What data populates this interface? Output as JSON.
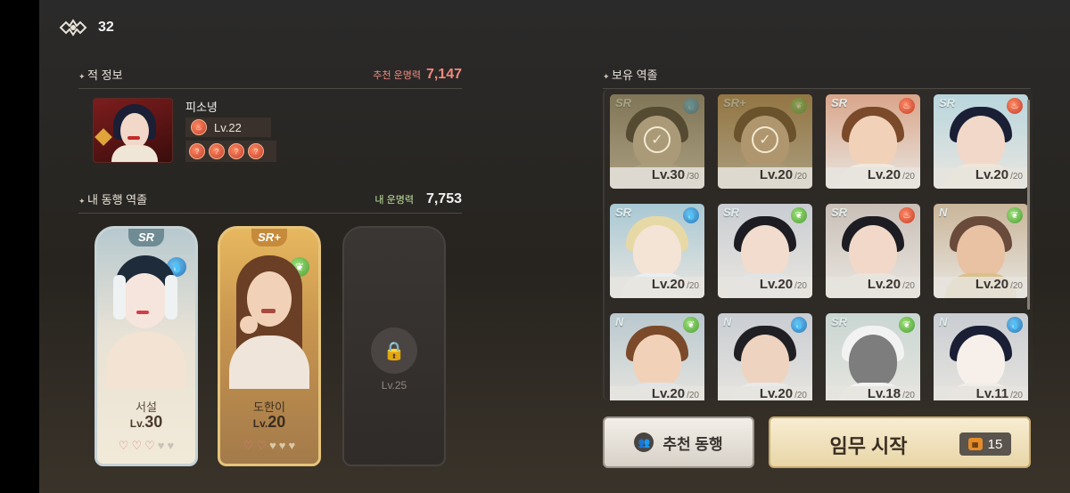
{
  "currency": {
    "icon": "pattern-knot-icon",
    "value": "32"
  },
  "enemy_section": {
    "title": "적 정보",
    "power_label": "추천 운명력",
    "power_value": "7,147",
    "power_color": "#f08a7e",
    "name": "피소녕",
    "level": "Lv.22",
    "element": "fire",
    "element_chips": [
      "?",
      "?",
      "?",
      "?"
    ]
  },
  "party_section": {
    "title": "내 동행 역졸",
    "power_label": "내 운명력",
    "power_value": "7,753",
    "power_color": "#bfe6a0",
    "members": [
      {
        "rank": "SR",
        "element": "water",
        "name": "서설",
        "level_prefix": "Lv.",
        "level": "30",
        "hearts_filled": 3,
        "hearts_total": 5
      },
      {
        "rank": "SR+",
        "element": "leaf",
        "name": "도한이",
        "level_prefix": "Lv.",
        "level": "20",
        "hearts_filled": 2,
        "hearts_total": 5
      }
    ],
    "locked_slot": {
      "label": "Lv.25"
    }
  },
  "owned_section": {
    "title": "보유 역졸",
    "units": [
      {
        "rank": "SR",
        "element": "water",
        "level": "Lv.30",
        "max": "/30",
        "selected": true
      },
      {
        "rank": "SR+",
        "element": "leaf",
        "level": "Lv.20",
        "max": "/20",
        "selected": true
      },
      {
        "rank": "SR",
        "element": "fire",
        "level": "Lv.20",
        "max": "/20",
        "selected": false
      },
      {
        "rank": "SR",
        "element": "fire",
        "level": "Lv.20",
        "max": "/20",
        "selected": false
      },
      {
        "rank": "SR",
        "element": "water",
        "level": "Lv.20",
        "max": "/20",
        "selected": false
      },
      {
        "rank": "SR",
        "element": "leaf",
        "level": "Lv.20",
        "max": "/20",
        "selected": false
      },
      {
        "rank": "SR",
        "element": "fire",
        "level": "Lv.20",
        "max": "/20",
        "selected": false
      },
      {
        "rank": "N",
        "element": "leaf",
        "level": "Lv.20",
        "max": "/20",
        "selected": false
      },
      {
        "rank": "N",
        "element": "leaf",
        "level": "Lv.20",
        "max": "/20",
        "selected": false
      },
      {
        "rank": "N",
        "element": "water",
        "level": "Lv.20",
        "max": "/20",
        "selected": false
      },
      {
        "rank": "SR",
        "element": "leaf",
        "level": "Lv.18",
        "max": "/20",
        "selected": false
      },
      {
        "rank": "N",
        "element": "water",
        "level": "Lv.11",
        "max": "/20",
        "selected": false
      }
    ]
  },
  "buttons": {
    "recommend": "추천 동행",
    "start": "임무 시작",
    "start_cost": "15"
  }
}
